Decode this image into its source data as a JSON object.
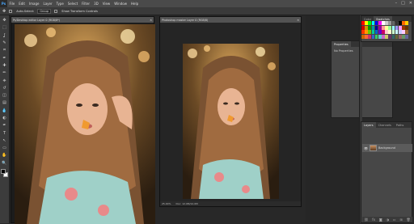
{
  "app": {
    "logo": "Ps"
  },
  "menu": [
    "File",
    "Edit",
    "Image",
    "Layer",
    "Type",
    "Select",
    "Filter",
    "3D",
    "View",
    "Window",
    "Help"
  ],
  "window_controls": {
    "min": "–",
    "max": "□",
    "close": "✕"
  },
  "options_bar": {
    "auto_select_label": "Auto-Select:",
    "auto_select_value": "Group",
    "show_transform_label": "Show Transform Controls"
  },
  "tools": [
    "move-icon",
    "marquee-icon",
    "lasso-icon",
    "quick-select-icon",
    "crop-icon",
    "eyedropper-icon",
    "healing-icon",
    "brush-icon",
    "stamp-icon",
    "history-brush-icon",
    "eraser-icon",
    "gradient-icon",
    "blur-icon",
    "dodge-icon",
    "pen-icon",
    "type-icon",
    "path-select-icon",
    "shape-icon",
    "hand-icon",
    "zoom-icon"
  ],
  "tool_glyphs": [
    "✥",
    "⬚",
    "ʆ",
    "✎",
    "⌗",
    "✒",
    "✚",
    "✏",
    "⎈",
    "↺",
    "◫",
    "▤",
    "💧",
    "◐",
    "✒",
    "T",
    "↖",
    "▭",
    "✋",
    "🔍"
  ],
  "doc1": {
    "title": "Ps/Desktop editor Layer 0 (RGB/8*)",
    "close": "✕"
  },
  "doc2": {
    "title": "Photoshop master Layer 0 (RGB/8)",
    "close": "✕",
    "zoom": "25.00%",
    "doc_info": "Doc: 12.0M/12.0M"
  },
  "properties_panel": {
    "tab": "Properties",
    "body": "No Properties"
  },
  "swatches_panel": {
    "tabs": [
      "Color",
      "Swatches"
    ]
  },
  "swatch_colors": [
    "#ff0000",
    "#ffff00",
    "#00ff00",
    "#00ffff",
    "#0000ff",
    "#ff00ff",
    "#ffffff",
    "#cccccc",
    "#999999",
    "#666666",
    "#333333",
    "#000000",
    "#ff6600",
    "#ffcc00",
    "#cc0000",
    "#cc9900",
    "#009900",
    "#009999",
    "#000099",
    "#990099",
    "#ff9999",
    "#ffff99",
    "#99ff99",
    "#99ffff",
    "#9999ff",
    "#ff99ff",
    "#993300",
    "#663300",
    "#ff3300",
    "#ff9900",
    "#66cc00",
    "#00cc99",
    "#0066cc",
    "#6600cc",
    "#cc0066",
    "#ffcccc",
    "#ffffcc",
    "#ccffcc",
    "#ccffff",
    "#ccccff",
    "#ffccff",
    "#996633",
    "#cc6600",
    "#ff6633",
    "#cc3366",
    "#3366cc",
    "#33cc66",
    "#66cccc",
    "#cc66cc",
    "#cccc66",
    "#663366",
    "#336666",
    "#666633",
    "#996666",
    "#669966",
    "#666699"
  ],
  "layers_panel": {
    "tabs": [
      "Layers",
      "Channels",
      "Paths"
    ],
    "layer_name": "Background",
    "footer_icons": [
      "link-icon",
      "fx-icon",
      "mask-icon",
      "adjustment-icon",
      "folder-icon",
      "new-layer-icon",
      "trash-icon"
    ],
    "footer_glyphs": [
      "⛓",
      "fx",
      "◙",
      "◑",
      "▭",
      "⊞",
      "🗑"
    ]
  }
}
